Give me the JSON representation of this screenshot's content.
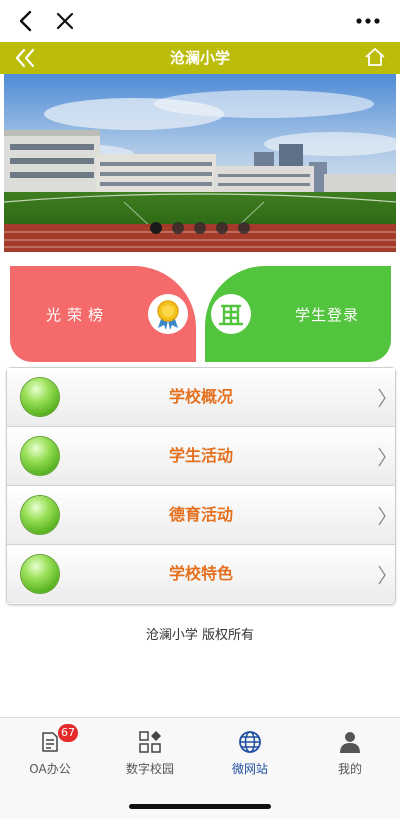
{
  "navbar": {
    "title": "沧澜小学"
  },
  "cards": {
    "honor": {
      "label": "光荣榜"
    },
    "student_login": {
      "label": "学生登录"
    }
  },
  "menu": [
    {
      "label": "学校概况"
    },
    {
      "label": "学生活动"
    },
    {
      "label": "德育活动"
    },
    {
      "label": "学校特色"
    }
  ],
  "footer": {
    "copyright": "沧澜小学 版权所有"
  },
  "tabbar": [
    {
      "label": "OA办公",
      "icon": "document-icon",
      "badge": "67"
    },
    {
      "label": "数字校园",
      "icon": "grid-icon"
    },
    {
      "label": "微网站",
      "icon": "globe-icon",
      "active": true
    },
    {
      "label": "我的",
      "icon": "person-icon"
    }
  ],
  "carousel": {
    "slides": 5,
    "active_index": 0
  },
  "colors": {
    "navbar": "#bcbc0a",
    "honor_card": "#f56a6a",
    "login_card": "#53c43e",
    "menu_text": "#e4701e",
    "active_tab": "#1f4fa0"
  }
}
